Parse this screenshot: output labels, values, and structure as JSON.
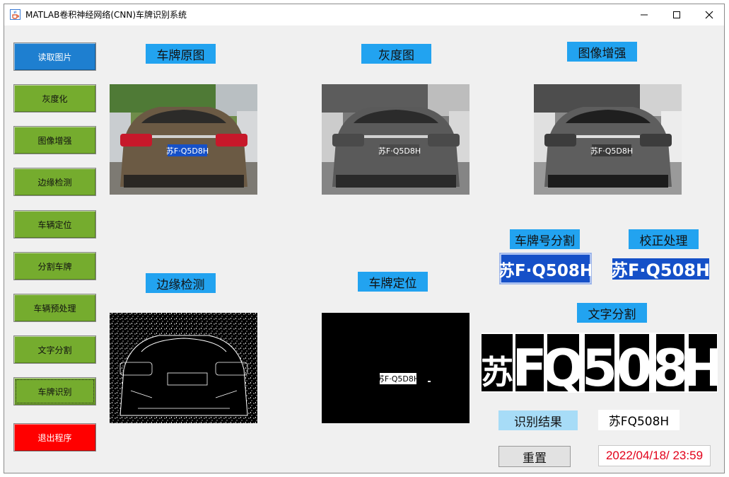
{
  "window": {
    "title": "MATLAB卷积神经网络(CNN)车牌识别系统",
    "icon": "java-cup-icon",
    "controls": [
      "minimize-icon",
      "maximize-icon",
      "close-icon"
    ]
  },
  "sidebar": {
    "buttons": [
      {
        "label": "读取图片",
        "color": "#1e7fd0"
      },
      {
        "label": "灰度化",
        "color": "#75ac2e"
      },
      {
        "label": "图像增强",
        "color": "#75ac2e"
      },
      {
        "label": "边缘检测",
        "color": "#75ac2e"
      },
      {
        "label": "车辆定位",
        "color": "#75ac2e"
      },
      {
        "label": "分割车牌",
        "color": "#75ac2e"
      },
      {
        "label": "车辆预处理",
        "color": "#75ac2e"
      },
      {
        "label": "文字分割",
        "color": "#75ac2e"
      },
      {
        "label": "车牌识别",
        "color": "#75ac2e"
      },
      {
        "label": "退出程序",
        "color": "#ff0000"
      }
    ]
  },
  "panels": {
    "original": {
      "label": "车牌原图"
    },
    "gray": {
      "label": "灰度图"
    },
    "enhanced": {
      "label": "图像增强"
    },
    "edge": {
      "label": "边缘检测"
    },
    "locate": {
      "label": "车牌定位"
    },
    "plate_seg": {
      "label": "车牌号分割"
    },
    "correction": {
      "label": "校正处理"
    },
    "char_seg": {
      "label": "文字分割"
    }
  },
  "plate": {
    "text": "苏F·Q508H",
    "text_small": "苏F·Q5D8H",
    "chars": [
      "苏",
      "F",
      "Q",
      "5",
      "0",
      "8",
      "H"
    ]
  },
  "result": {
    "label": "识别结果",
    "value": "苏FQ508H"
  },
  "reset_label": "重置",
  "datetime": "2022/04/18/ 23:59",
  "colors": {
    "label_blue": "#22a3f0",
    "result_label_bg": "#a7dcf7",
    "plate_blue": "#1550c8",
    "datetime_red": "#e2001a"
  }
}
